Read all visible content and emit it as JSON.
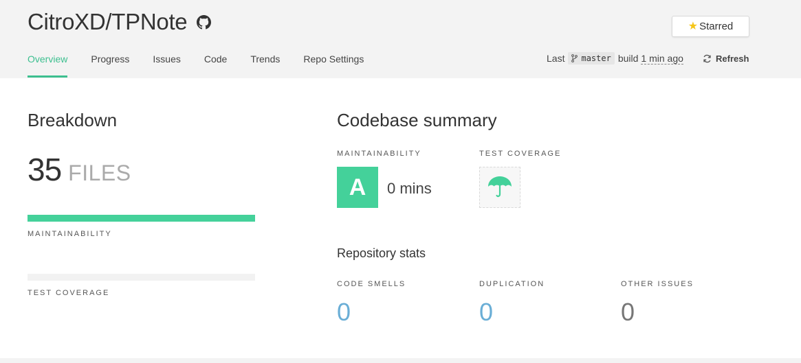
{
  "header": {
    "repo_name": "CitroXD/TPNote",
    "star_label": "Starred",
    "nav": [
      {
        "label": "Overview",
        "active": true
      },
      {
        "label": "Progress",
        "active": false
      },
      {
        "label": "Issues",
        "active": false
      },
      {
        "label": "Code",
        "active": false
      },
      {
        "label": "Trends",
        "active": false
      },
      {
        "label": "Repo Settings",
        "active": false
      }
    ],
    "build": {
      "prefix": "Last",
      "branch": "master",
      "mid": "build",
      "ago": "1 min ago"
    },
    "refresh_label": "Refresh"
  },
  "breakdown": {
    "title": "Breakdown",
    "files_count": "35",
    "files_unit": "FILES",
    "maintainability_label": "MAINTAINABILITY",
    "maintainability_fill": 1.0,
    "coverage_label": "TEST COVERAGE",
    "coverage_fill": 0.0
  },
  "summary": {
    "title": "Codebase summary",
    "maintainability_label": "MAINTAINABILITY",
    "grade": "A",
    "time": "0 mins",
    "coverage_label": "TEST COVERAGE",
    "coverage_icon": "umbrella-icon"
  },
  "stats": {
    "title": "Repository stats",
    "items": [
      {
        "label": "CODE SMELLS",
        "value": "0",
        "color": "#6aaed6"
      },
      {
        "label": "DUPLICATION",
        "value": "0",
        "color": "#6aaed6"
      },
      {
        "label": "OTHER ISSUES",
        "value": "0",
        "color": "#777777"
      }
    ]
  },
  "colors": {
    "accent": "#3cbf8f",
    "grade_bg": "#44d19a",
    "star": "#f5c518"
  }
}
